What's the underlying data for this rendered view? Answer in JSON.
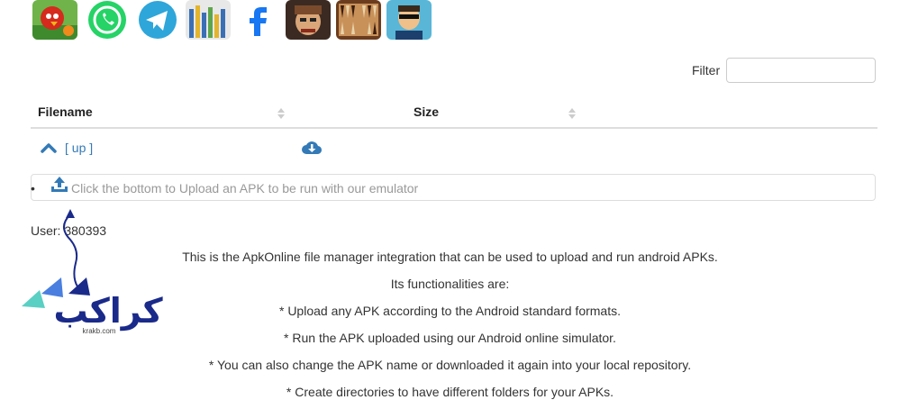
{
  "filter": {
    "label": "Filter",
    "value": ""
  },
  "table": {
    "columns": [
      "Filename",
      "Size"
    ],
    "up_label": "[ up ]"
  },
  "upload": {
    "text": "Click the bottom to Upload an APK to be run with our emulator",
    "bullet": "•"
  },
  "user": {
    "text": "User: 380393"
  },
  "description": [
    "This is the ApkOnline file manager integration that can be used to upload and run android APKs.",
    "Its functionalities are:",
    "* Upload any APK according to the Android standard formats.",
    "* Run the APK uploaded using our Android online simulator.",
    "* You can also change the APK name or downloaded it again into your local repository.",
    "* Create directories to have different folders for your APKs."
  ],
  "watermark": {
    "text": "کراکب",
    "domain": "krakb.com"
  },
  "app_icons": [
    "angry-birds-icon",
    "whatsapp-icon",
    "telegram-icon",
    "equalizer-app-icon",
    "facebook-icon",
    "game-character-icon",
    "backgammon-icon",
    "agent-character-icon"
  ],
  "colors": {
    "link": "#337ab7",
    "upload_icon": "#337ab7",
    "arrow": "#1a2a8a",
    "watermark_text": "#1a2a8a"
  }
}
